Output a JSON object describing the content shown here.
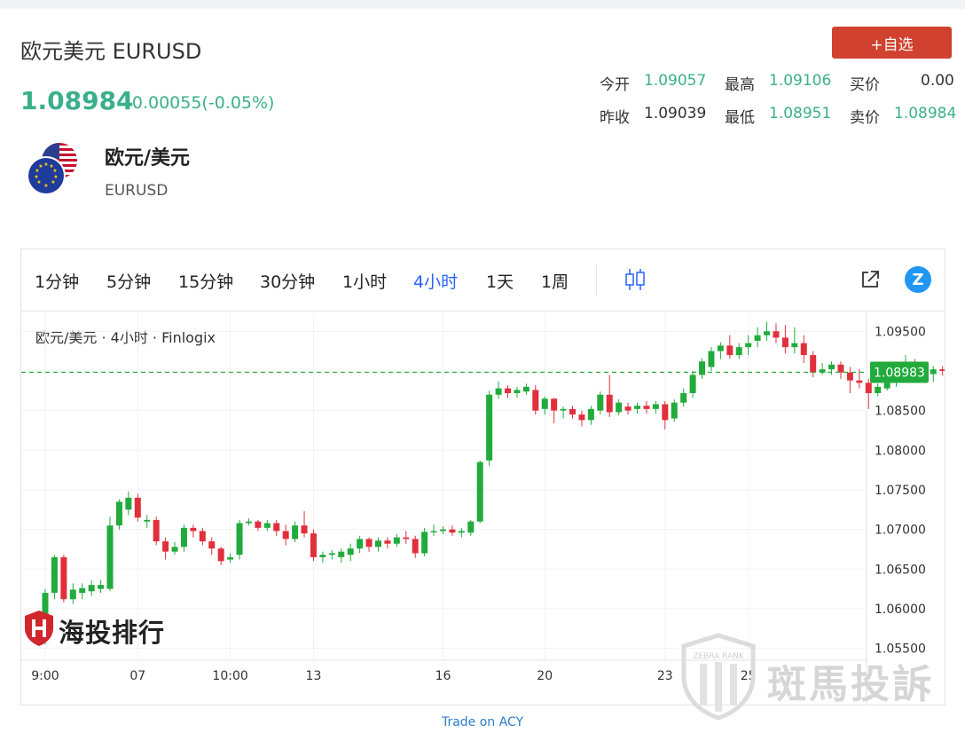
{
  "header": {
    "title": "欧元美元 EURUSD",
    "add_button": "+自选",
    "price": "1.08984",
    "change": "-0.00055(-0.05%)"
  },
  "quote": {
    "open_label": "今开",
    "open_value": "1.09057",
    "high_label": "最高",
    "high_value": "1.09106",
    "bid_label": "买价",
    "bid_value": "0.00",
    "prev_label": "昨收",
    "prev_value": "1.09039",
    "low_label": "最低",
    "low_value": "1.08951",
    "ask_label": "卖价",
    "ask_value": "1.08984"
  },
  "pair": {
    "name": "欧元/美元",
    "symbol": "EURUSD",
    "flag_icon": "eu-us-flag-icon"
  },
  "toolbar": {
    "timeframes": [
      "1分钟",
      "5分钟",
      "15分钟",
      "30分钟",
      "1小时",
      "4小时",
      "1天",
      "1周"
    ],
    "active_timeframe": "4小时",
    "zlogo_label": "Z"
  },
  "chart_legend": "欧元/美元 · 4小时 · Finlogix",
  "footer_link": "Trade on ACY",
  "watermarks": {
    "left": "海投排行",
    "right": "斑馬投訴",
    "right_badge": "ZEBRA RANK"
  },
  "colors": {
    "up": "#22ab3c",
    "down": "#e0303c",
    "accent": "#3ab08a",
    "button": "#d0412f",
    "link": "#2a7dc9",
    "current_price_tag": "#22ab3c"
  },
  "chart_data": {
    "type": "candlestick",
    "timeframe": "4小时",
    "last_price": 1.08983,
    "last_price_label": "1.08983",
    "ylim": [
      1.0535,
      1.0975
    ],
    "y_ticks": [
      1.095,
      1.085,
      1.08,
      1.075,
      1.07,
      1.065,
      1.06,
      1.055
    ],
    "y_tick_labels": [
      "1.09500",
      "1.08500",
      "1.08000",
      "1.07500",
      "1.07000",
      "1.06500",
      "1.06000",
      "1.05500"
    ],
    "x_ticks": [
      {
        "label": "9:00",
        "index": 0
      },
      {
        "label": "07",
        "index": 10
      },
      {
        "label": "10:00",
        "index": 20
      },
      {
        "label": "13",
        "index": 29
      },
      {
        "label": "16",
        "index": 43
      },
      {
        "label": "20",
        "index": 54
      },
      {
        "label": "23",
        "index": 67
      },
      {
        "label": "25",
        "index": 76
      }
    ],
    "candles": [
      [
        1.056,
        1.062,
        1.0555,
        1.0625
      ],
      [
        1.062,
        1.0665,
        1.0612,
        1.0668
      ],
      [
        1.0665,
        1.0612,
        1.0608,
        1.0668
      ],
      [
        1.0612,
        1.0624,
        1.0606,
        1.0632
      ],
      [
        1.062,
        1.0626,
        1.0612,
        1.0632
      ],
      [
        1.0622,
        1.063,
        1.0616,
        1.0636
      ],
      [
        1.0625,
        1.063,
        1.062,
        1.0636
      ],
      [
        1.0625,
        1.0705,
        1.0622,
        1.0716
      ],
      [
        1.0705,
        1.0735,
        1.07,
        1.0738
      ],
      [
        1.0725,
        1.074,
        1.0718,
        1.0748
      ],
      [
        1.074,
        1.0715,
        1.071,
        1.0745
      ],
      [
        1.071,
        1.0712,
        1.0702,
        1.0718
      ],
      [
        1.0712,
        1.0685,
        1.068,
        1.0716
      ],
      [
        1.0685,
        1.0672,
        1.0662,
        1.069
      ],
      [
        1.0672,
        1.0678,
        1.0668,
        1.0684
      ],
      [
        1.0678,
        1.0702,
        1.0672,
        1.0706
      ],
      [
        1.0702,
        1.0698,
        1.069,
        1.0706
      ],
      [
        1.0698,
        1.0685,
        1.068,
        1.0702
      ],
      [
        1.0685,
        1.0676,
        1.0668,
        1.069
      ],
      [
        1.0676,
        1.066,
        1.0655,
        1.0678
      ],
      [
        1.0662,
        1.0665,
        1.0658,
        1.067
      ],
      [
        1.0668,
        1.0708,
        1.0662,
        1.0712
      ],
      [
        1.0708,
        1.071,
        1.0705,
        1.0714
      ],
      [
        1.071,
        1.0702,
        1.0698,
        1.0712
      ],
      [
        1.0702,
        1.0708,
        1.0698,
        1.0712
      ],
      [
        1.0708,
        1.0698,
        1.0692,
        1.0712
      ],
      [
        1.0698,
        1.0688,
        1.068,
        1.0706
      ],
      [
        1.0688,
        1.0705,
        1.0684,
        1.071
      ],
      [
        1.0705,
        1.0695,
        1.069,
        1.0723
      ],
      [
        1.0695,
        1.0665,
        1.066,
        1.07
      ],
      [
        1.0665,
        1.0668,
        1.0658,
        1.0672
      ],
      [
        1.0668,
        1.067,
        1.0662,
        1.0674
      ],
      [
        1.0665,
        1.0672,
        1.0658,
        1.0676
      ],
      [
        1.0668,
        1.0676,
        1.066,
        1.0682
      ],
      [
        1.0676,
        1.0688,
        1.067,
        1.0692
      ],
      [
        1.0688,
        1.0678,
        1.0672,
        1.069
      ],
      [
        1.0678,
        1.0686,
        1.0672,
        1.069
      ],
      [
        1.0686,
        1.0682,
        1.0676,
        1.069
      ],
      [
        1.0682,
        1.069,
        1.0678,
        1.0694
      ],
      [
        1.069,
        1.0688,
        1.0682,
        1.0698
      ],
      [
        1.0688,
        1.067,
        1.0664,
        1.0692
      ],
      [
        1.067,
        1.0697,
        1.0666,
        1.0702
      ],
      [
        1.0697,
        1.0698,
        1.0692,
        1.0706
      ],
      [
        1.0698,
        1.07,
        1.0694,
        1.0704
      ],
      [
        1.07,
        1.0696,
        1.0692,
        1.0705
      ],
      [
        1.0696,
        1.0698,
        1.069,
        1.0702
      ],
      [
        1.0696,
        1.071,
        1.0692,
        1.0712
      ],
      [
        1.071,
        1.0785,
        1.0708,
        1.0787
      ],
      [
        1.0787,
        1.087,
        1.078,
        1.0875
      ],
      [
        1.087,
        1.0878,
        1.0865,
        1.0887
      ],
      [
        1.0878,
        1.0872,
        1.0866,
        1.0882
      ],
      [
        1.0872,
        1.0876,
        1.0866,
        1.088
      ],
      [
        1.0874,
        1.088,
        1.087,
        1.0884
      ],
      [
        1.0876,
        1.085,
        1.0845,
        1.0882
      ],
      [
        1.0852,
        1.0865,
        1.0845,
        1.0868
      ],
      [
        1.0865,
        1.085,
        1.0834,
        1.0866
      ],
      [
        1.085,
        1.0852,
        1.084,
        1.0855
      ],
      [
        1.0852,
        1.0845,
        1.084,
        1.0856
      ],
      [
        1.0845,
        1.0838,
        1.083,
        1.085
      ],
      [
        1.0838,
        1.0852,
        1.0832,
        1.0856
      ],
      [
        1.085,
        1.087,
        1.0845,
        1.0874
      ],
      [
        1.087,
        1.0848,
        1.0842,
        1.0895
      ],
      [
        1.0848,
        1.086,
        1.0844,
        1.0864
      ],
      [
        1.0855,
        1.085,
        1.0845,
        1.086
      ],
      [
        1.0852,
        1.0856,
        1.0846,
        1.086
      ],
      [
        1.0856,
        1.0852,
        1.0846,
        1.0862
      ],
      [
        1.0852,
        1.0858,
        1.0846,
        1.0862
      ],
      [
        1.0858,
        1.0838,
        1.0826,
        1.0862
      ],
      [
        1.084,
        1.086,
        1.0836,
        1.0864
      ],
      [
        1.086,
        1.0872,
        1.0855,
        1.0878
      ],
      [
        1.0872,
        1.0895,
        1.0866,
        1.09
      ],
      [
        1.0895,
        1.0912,
        1.089,
        1.0916
      ],
      [
        1.0905,
        1.0925,
        1.09,
        1.093
      ],
      [
        1.0925,
        1.0932,
        1.0915,
        1.0936
      ],
      [
        1.0932,
        1.092,
        1.0915,
        1.0945
      ],
      [
        1.092,
        1.093,
        1.0915,
        1.0935
      ],
      [
        1.093,
        1.0935,
        1.092,
        1.0945
      ],
      [
        1.0938,
        1.0945,
        1.093,
        1.0955
      ],
      [
        1.0945,
        1.095,
        1.0938,
        1.0962
      ],
      [
        1.095,
        1.0942,
        1.0935,
        1.096
      ],
      [
        1.0942,
        1.093,
        1.0922,
        1.0958
      ],
      [
        1.093,
        1.0935,
        1.0922,
        1.0955
      ],
      [
        1.0935,
        1.092,
        1.091,
        1.0945
      ],
      [
        1.092,
        1.0898,
        1.0892,
        1.0925
      ],
      [
        1.0898,
        1.0902,
        1.0895,
        1.091
      ],
      [
        1.0902,
        1.0908,
        1.0895,
        1.0912
      ],
      [
        1.0908,
        1.0898,
        1.089,
        1.0912
      ],
      [
        1.0898,
        1.0888,
        1.0872,
        1.0905
      ],
      [
        1.0888,
        1.0885,
        1.0878,
        1.0902
      ],
      [
        1.0885,
        1.0872,
        1.0852,
        1.089
      ],
      [
        1.0872,
        1.088,
        1.0868,
        1.0884
      ],
      [
        1.0878,
        1.0885,
        1.0875,
        1.089
      ],
      [
        1.0885,
        1.09,
        1.088,
        1.0905
      ],
      [
        1.09,
        1.091,
        1.0895,
        1.092
      ],
      [
        1.091,
        1.0905,
        1.0895,
        1.0915
      ],
      [
        1.0898,
        1.0896,
        1.0888,
        1.0906
      ],
      [
        1.0896,
        1.0902,
        1.0886,
        1.0906
      ],
      [
        1.0902,
        1.09,
        1.0894,
        1.0906
      ],
      [
        1.09,
        1.0902,
        1.0894,
        1.0906
      ],
      [
        1.0902,
        1.0898,
        1.0895,
        1.0905
      ]
    ]
  }
}
